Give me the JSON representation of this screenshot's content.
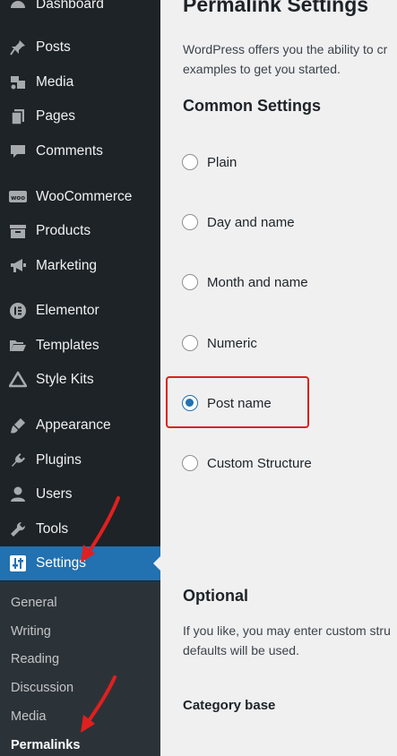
{
  "sidebar": {
    "dashboard": "Dashboard",
    "posts": "Posts",
    "media": "Media",
    "pages": "Pages",
    "comments": "Comments",
    "woocommerce": "WooCommerce",
    "products": "Products",
    "marketing": "Marketing",
    "elementor": "Elementor",
    "templates": "Templates",
    "style_kits": "Style Kits",
    "appearance": "Appearance",
    "plugins": "Plugins",
    "users": "Users",
    "tools": "Tools",
    "settings": "Settings",
    "submenu": {
      "general": "General",
      "writing": "Writing",
      "reading": "Reading",
      "discussion": "Discussion",
      "media": "Media",
      "permalinks": "Permalinks"
    }
  },
  "main": {
    "title": "Permalink Settings",
    "desc_line1": "WordPress offers you the ability to cr",
    "desc_line2": "examples to get you started.",
    "common_settings": "Common Settings",
    "options": {
      "plain": "Plain",
      "day_name": "Day and name",
      "month_name": "Month and name",
      "numeric": "Numeric",
      "post_name": "Post name",
      "custom": "Custom Structure"
    },
    "selected_option": "Post name",
    "optional": "Optional",
    "optional_line1": "If you like, you may enter custom stru",
    "optional_line2": "defaults will be used.",
    "category_base": "Category base"
  },
  "colors": {
    "sidebar_bg": "#1d2327",
    "active_bg": "#2271b1",
    "annotation_red": "#e0201f"
  }
}
